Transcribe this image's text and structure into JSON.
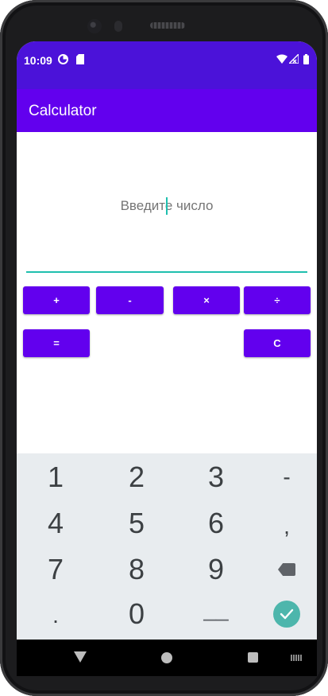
{
  "status_bar": {
    "time": "10:09",
    "icons": [
      "data-saver-icon",
      "sd-card-icon",
      "wifi-icon",
      "signal-icon",
      "battery-icon"
    ]
  },
  "app_bar": {
    "title": "Calculator"
  },
  "input": {
    "placeholder": "Введите число",
    "value": ""
  },
  "buttons": {
    "plus": "+",
    "minus": "-",
    "multiply": "×",
    "divide": "÷",
    "equals": "=",
    "clear": "C"
  },
  "keyboard": {
    "rows": [
      [
        "1",
        "2",
        "3",
        "-"
      ],
      [
        "4",
        "5",
        "6",
        ","
      ],
      [
        "7",
        "8",
        "9",
        "backspace-icon"
      ],
      [
        ".",
        "0",
        "__",
        "enter-icon"
      ]
    ]
  },
  "colors": {
    "status_bar": "#4b12d9",
    "app_bar": "#6200ee",
    "accent": "#1fbfae",
    "button": "#6200ee",
    "keyboard_bg": "#e8ecef",
    "enter_key": "#4db6ac"
  },
  "nav_bar": {
    "icons": [
      "back-icon",
      "home-icon",
      "recents-icon",
      "keyboard-switch-icon"
    ]
  }
}
